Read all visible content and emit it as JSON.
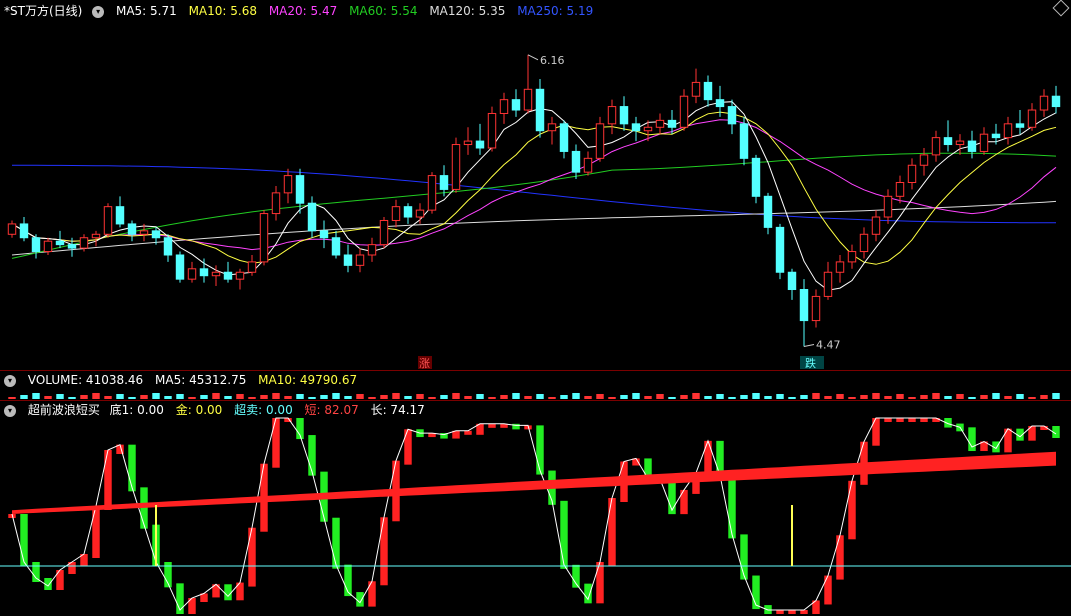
{
  "colors": {
    "up": "#ff3333",
    "down": "#54ffff",
    "ma5": "#ffffff",
    "ma10": "#ffff44",
    "ma20": "#ff44ff",
    "ma60": "#22cc22",
    "ma120": "#dddddd",
    "ma250": "#2233ff",
    "ind_red": "#ff2222",
    "ind_green": "#22ee22",
    "ind_trend_green": "#55cc55",
    "ind_yellow": "#ffff55",
    "cyan": "#66ffff"
  },
  "main": {
    "title": "*ST万方(日线)",
    "ma5_label": "MA5: 5.71",
    "ma10_label": "MA10: 5.68",
    "ma20_label": "MA20: 5.47",
    "ma60_label": "MA60: 5.54",
    "ma120_label": "MA120: 5.35",
    "ma250_label": "MA250: 5.19",
    "high_label": "6.16",
    "low_label": "4.47",
    "limit_up_tag": "涨",
    "limit_down_tag": "跌"
  },
  "volume": {
    "title": "VOLUME: 41038.46",
    "ma5": "MA5: 45312.75",
    "ma10": "MA10: 49790.67"
  },
  "indicator": {
    "name": "超前波浪短买",
    "di": "底1: 0.00",
    "jin": "金: 0.00",
    "chaomai": "超卖: 0.00",
    "duan": "短: 82.07",
    "chang": "长: 74.17"
  },
  "chart_data": {
    "type": "candlestick",
    "title": "*ST万方(日线)",
    "annotations": {
      "high": 6.16,
      "low": 4.47
    },
    "moving_averages": {
      "MA5": 5.71,
      "MA10": 5.68,
      "MA20": 5.47,
      "MA60": 5.54,
      "MA120": 5.35,
      "MA250": 5.19
    },
    "x_count": 88,
    "candles_ohlc": [
      [
        5.12,
        5.2,
        5.1,
        5.18
      ],
      [
        5.18,
        5.22,
        5.08,
        5.1
      ],
      [
        5.1,
        5.12,
        4.98,
        5.02
      ],
      [
        5.02,
        5.1,
        5.0,
        5.08
      ],
      [
        5.08,
        5.14,
        5.04,
        5.06
      ],
      [
        5.06,
        5.1,
        4.99,
        5.04
      ],
      [
        5.04,
        5.12,
        5.02,
        5.1
      ],
      [
        5.1,
        5.14,
        5.05,
        5.12
      ],
      [
        5.12,
        5.3,
        5.1,
        5.28
      ],
      [
        5.28,
        5.34,
        5.16,
        5.18
      ],
      [
        5.18,
        5.2,
        5.08,
        5.12
      ],
      [
        5.12,
        5.18,
        5.08,
        5.14
      ],
      [
        5.14,
        5.16,
        5.06,
        5.1
      ],
      [
        5.1,
        5.12,
        4.96,
        5.0
      ],
      [
        5.0,
        5.02,
        4.84,
        4.86
      ],
      [
        4.86,
        4.96,
        4.84,
        4.92
      ],
      [
        4.92,
        4.98,
        4.84,
        4.88
      ],
      [
        4.88,
        4.94,
        4.82,
        4.9
      ],
      [
        4.9,
        4.96,
        4.84,
        4.86
      ],
      [
        4.86,
        4.92,
        4.8,
        4.9
      ],
      [
        4.9,
        5.0,
        4.88,
        4.96
      ],
      [
        4.96,
        5.26,
        4.94,
        5.24
      ],
      [
        5.24,
        5.4,
        5.2,
        5.36
      ],
      [
        5.36,
        5.5,
        5.3,
        5.46
      ],
      [
        5.46,
        5.5,
        5.24,
        5.3
      ],
      [
        5.3,
        5.34,
        5.1,
        5.14
      ],
      [
        5.14,
        5.2,
        5.04,
        5.1
      ],
      [
        5.1,
        5.14,
        4.98,
        5.0
      ],
      [
        5.0,
        5.06,
        4.9,
        4.94
      ],
      [
        4.94,
        5.04,
        4.9,
        5.0
      ],
      [
        5.0,
        5.1,
        4.96,
        5.06
      ],
      [
        5.06,
        5.22,
        5.04,
        5.2
      ],
      [
        5.2,
        5.32,
        5.16,
        5.28
      ],
      [
        5.28,
        5.3,
        5.18,
        5.22
      ],
      [
        5.22,
        5.3,
        5.18,
        5.26
      ],
      [
        5.26,
        5.48,
        5.24,
        5.46
      ],
      [
        5.46,
        5.52,
        5.34,
        5.38
      ],
      [
        5.38,
        5.68,
        5.36,
        5.64
      ],
      [
        5.64,
        5.74,
        5.58,
        5.66
      ],
      [
        5.66,
        5.76,
        5.58,
        5.62
      ],
      [
        5.62,
        5.86,
        5.6,
        5.82
      ],
      [
        5.82,
        5.94,
        5.76,
        5.9
      ],
      [
        5.9,
        5.96,
        5.8,
        5.84
      ],
      [
        5.84,
        6.16,
        5.82,
        5.96
      ],
      [
        5.96,
        6.02,
        5.68,
        5.72
      ],
      [
        5.72,
        5.8,
        5.64,
        5.76
      ],
      [
        5.76,
        5.78,
        5.56,
        5.6
      ],
      [
        5.6,
        5.64,
        5.44,
        5.48
      ],
      [
        5.48,
        5.6,
        5.46,
        5.56
      ],
      [
        5.56,
        5.8,
        5.54,
        5.76
      ],
      [
        5.76,
        5.9,
        5.7,
        5.86
      ],
      [
        5.86,
        5.92,
        5.72,
        5.76
      ],
      [
        5.76,
        5.8,
        5.66,
        5.72
      ],
      [
        5.72,
        5.78,
        5.66,
        5.74
      ],
      [
        5.74,
        5.82,
        5.7,
        5.78
      ],
      [
        5.78,
        5.84,
        5.7,
        5.74
      ],
      [
        5.74,
        5.96,
        5.72,
        5.92
      ],
      [
        5.92,
        6.08,
        5.88,
        6.0
      ],
      [
        6.0,
        6.04,
        5.86,
        5.9
      ],
      [
        5.9,
        5.98,
        5.8,
        5.86
      ],
      [
        5.86,
        5.9,
        5.7,
        5.76
      ],
      [
        5.76,
        5.8,
        5.52,
        5.56
      ],
      [
        5.56,
        5.58,
        5.3,
        5.34
      ],
      [
        5.34,
        5.36,
        5.12,
        5.16
      ],
      [
        5.16,
        5.18,
        4.86,
        4.9
      ],
      [
        4.9,
        4.92,
        4.74,
        4.8
      ],
      [
        4.8,
        4.86,
        4.47,
        4.62
      ],
      [
        4.62,
        4.8,
        4.58,
        4.76
      ],
      [
        4.76,
        4.96,
        4.74,
        4.9
      ],
      [
        4.9,
        5.0,
        4.84,
        4.96
      ],
      [
        4.96,
        5.06,
        4.92,
        5.02
      ],
      [
        5.02,
        5.16,
        4.98,
        5.12
      ],
      [
        5.12,
        5.26,
        5.08,
        5.22
      ],
      [
        5.22,
        5.38,
        5.18,
        5.34
      ],
      [
        5.34,
        5.46,
        5.3,
        5.42
      ],
      [
        5.42,
        5.56,
        5.38,
        5.52
      ],
      [
        5.52,
        5.62,
        5.46,
        5.58
      ],
      [
        5.58,
        5.72,
        5.54,
        5.68
      ],
      [
        5.68,
        5.78,
        5.6,
        5.64
      ],
      [
        5.64,
        5.7,
        5.58,
        5.66
      ],
      [
        5.66,
        5.72,
        5.56,
        5.6
      ],
      [
        5.6,
        5.74,
        5.58,
        5.7
      ],
      [
        5.7,
        5.76,
        5.64,
        5.68
      ],
      [
        5.68,
        5.8,
        5.64,
        5.76
      ],
      [
        5.76,
        5.84,
        5.7,
        5.74
      ],
      [
        5.74,
        5.88,
        5.72,
        5.84
      ],
      [
        5.84,
        5.96,
        5.8,
        5.92
      ],
      [
        5.92,
        5.98,
        5.82,
        5.86
      ]
    ],
    "volume_ma": {
      "VOLUME": 41038.46,
      "MA5": 45312.75,
      "MA10": 49790.67
    },
    "indicator_values": {
      "底1": 0.0,
      "金": 0.0,
      "超卖": 0.0,
      "短": 82.07,
      "长": 74.17
    }
  }
}
